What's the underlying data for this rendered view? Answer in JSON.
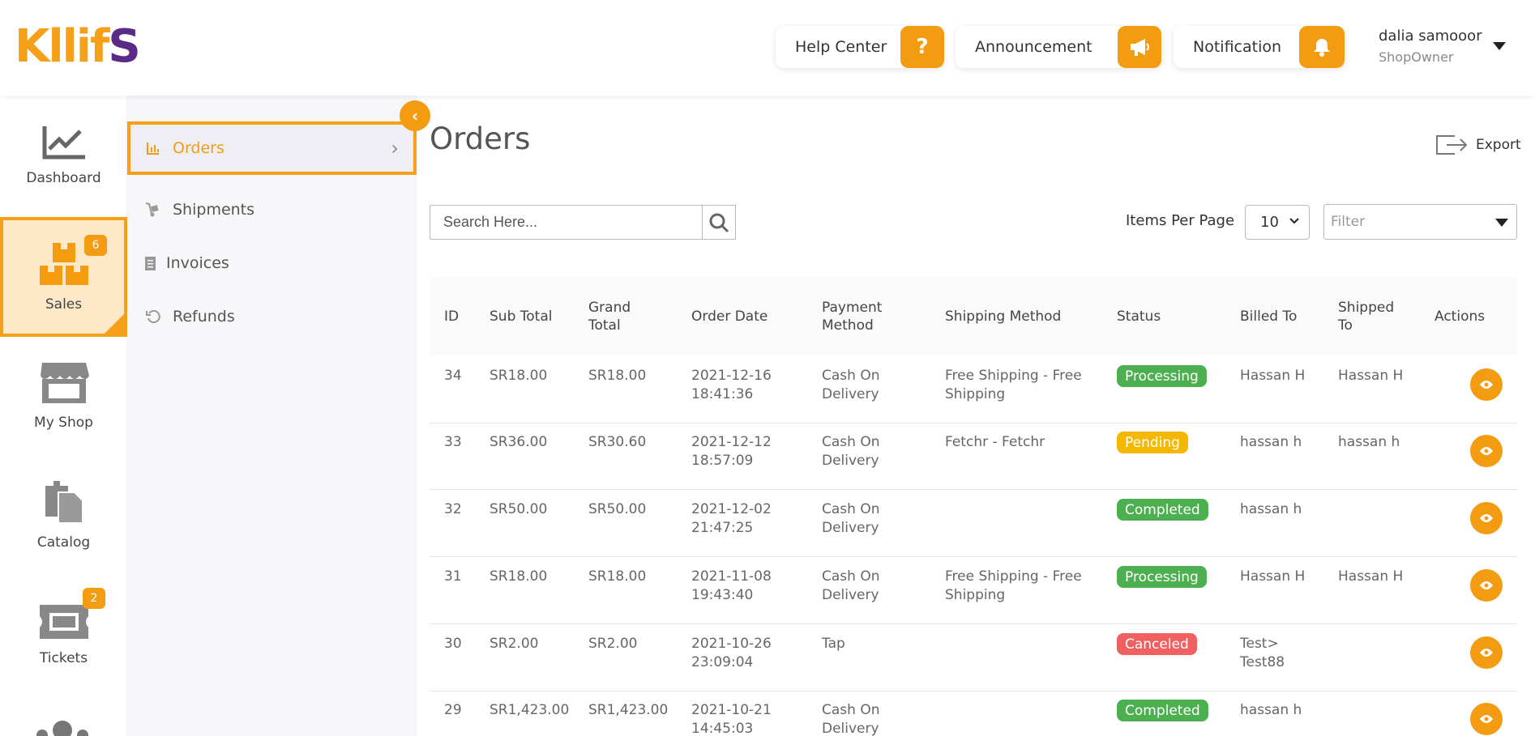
{
  "header": {
    "help_label": "Help Center",
    "help_icon": "?",
    "announcement_label": "Announcement",
    "notification_label": "Notification",
    "user_name": "dalia samooor",
    "user_role": "ShopOwner",
    "accent_color": "#f39c12"
  },
  "rail": {
    "dashboard": "Dashboard",
    "sales": "Sales",
    "sales_badge": "6",
    "myshop": "My Shop",
    "catalog": "Catalog",
    "tickets": "Tickets",
    "tickets_badge": "2"
  },
  "subnav": {
    "orders": "Orders",
    "shipments": "Shipments",
    "invoices": "Invoices",
    "refunds": "Refunds"
  },
  "main": {
    "title": "Orders",
    "export_label": "Export",
    "search_placeholder": "Search Here...",
    "items_per_page_label": "Items Per Page",
    "items_per_page_value": "10",
    "filter_placeholder": "Filter"
  },
  "table": {
    "headers": [
      "ID",
      "Sub Total",
      "Grand Total",
      "Order Date",
      "Payment Method",
      "Shipping Method",
      "Status",
      "Billed To",
      "Shipped To",
      "Actions"
    ],
    "rows": [
      {
        "id": "34",
        "sub": "SR18.00",
        "grand": "SR18.00",
        "date": "2021-12-16 18:41:36",
        "payment": "Cash On Delivery",
        "shipping": "Free Shipping - Free Shipping",
        "status": "Processing",
        "billed": "Hassan H",
        "shipped": "Hassan H"
      },
      {
        "id": "33",
        "sub": "SR36.00",
        "grand": "SR30.60",
        "date": "2021-12-12 18:57:09",
        "payment": "Cash On Delivery",
        "shipping": "Fetchr - Fetchr",
        "status": "Pending",
        "billed": "hassan h",
        "shipped": "hassan h"
      },
      {
        "id": "32",
        "sub": "SR50.00",
        "grand": "SR50.00",
        "date": "2021-12-02 21:47:25",
        "payment": "Cash On Delivery",
        "shipping": "",
        "status": "Completed",
        "billed": "hassan h",
        "shipped": ""
      },
      {
        "id": "31",
        "sub": "SR18.00",
        "grand": "SR18.00",
        "date": "2021-11-08 19:43:40",
        "payment": "Cash On Delivery",
        "shipping": "Free Shipping - Free Shipping",
        "status": "Processing",
        "billed": "Hassan H",
        "shipped": "Hassan H"
      },
      {
        "id": "30",
        "sub": "SR2.00",
        "grand": "SR2.00",
        "date": "2021-10-26 23:09:04",
        "payment": "Tap",
        "shipping": "",
        "status": "Canceled",
        "billed": "Test> Test88",
        "shipped": ""
      },
      {
        "id": "29",
        "sub": "SR1,423.00",
        "grand": "SR1,423.00",
        "date": "2021-10-21 14:45:03",
        "payment": "Cash On Delivery",
        "shipping": "",
        "status": "Completed",
        "billed": "hassan h",
        "shipped": ""
      }
    ]
  }
}
